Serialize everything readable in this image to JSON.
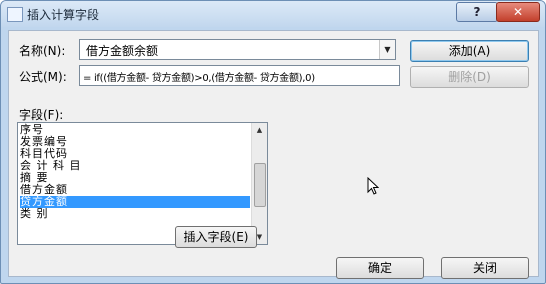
{
  "dialog": {
    "title": "插入计算字段",
    "help_label": "?",
    "close_label": "✕"
  },
  "name_field": {
    "label": "名称(N):",
    "value": "借方金额余额"
  },
  "formula_field": {
    "label": "公式(M):",
    "value": "= if((借方金额- 贷方金额)>0,(借方金额- 贷方金额),0)"
  },
  "buttons": {
    "add": "添加(A)",
    "delete": "删除(D)",
    "insert_field": "插入字段(E)",
    "ok": "确定",
    "close": "关闭"
  },
  "fields_list": {
    "label": "字段(F):",
    "items": [
      "序号",
      "发票编号",
      "科目代码",
      "会 计 科 目",
      "摘 要",
      "借方金额",
      "贷方金额",
      "类 别"
    ],
    "selected_index": 6
  }
}
